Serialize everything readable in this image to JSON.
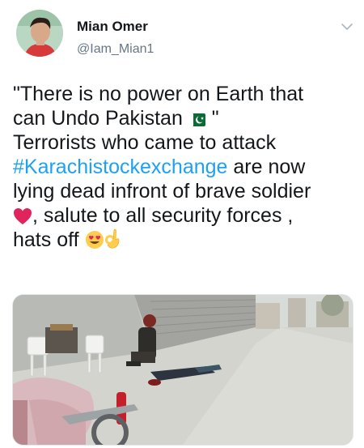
{
  "user": {
    "display_name": "Mian Omer",
    "handle": "@Iam_Mian1",
    "avatar_icon": "profile-avatar",
    "menu_icon": "chevron-down-icon"
  },
  "tweet": {
    "line1": "\"There is no power on Earth that",
    "line2": "can Undo Pakistan",
    "line2_quote": " \"",
    "line3": "Terrorists who came to attack",
    "line4_hashtag": "#Karachistockexchange",
    "line4_rest": " are now",
    "line5": "lying dead infront of brave soldier",
    "line6": ", salute to all security forces ,",
    "line7": "hats off",
    "emoji_flag": "pakistan-flag",
    "emoji_heart": "red-heart",
    "emoji_eyes": "heart-eyes-face",
    "emoji_ok": "ok-hand"
  },
  "media": {
    "description_icon": "street-photo"
  },
  "colors": {
    "link": "#1da1f2",
    "secondary_text": "#657786"
  }
}
